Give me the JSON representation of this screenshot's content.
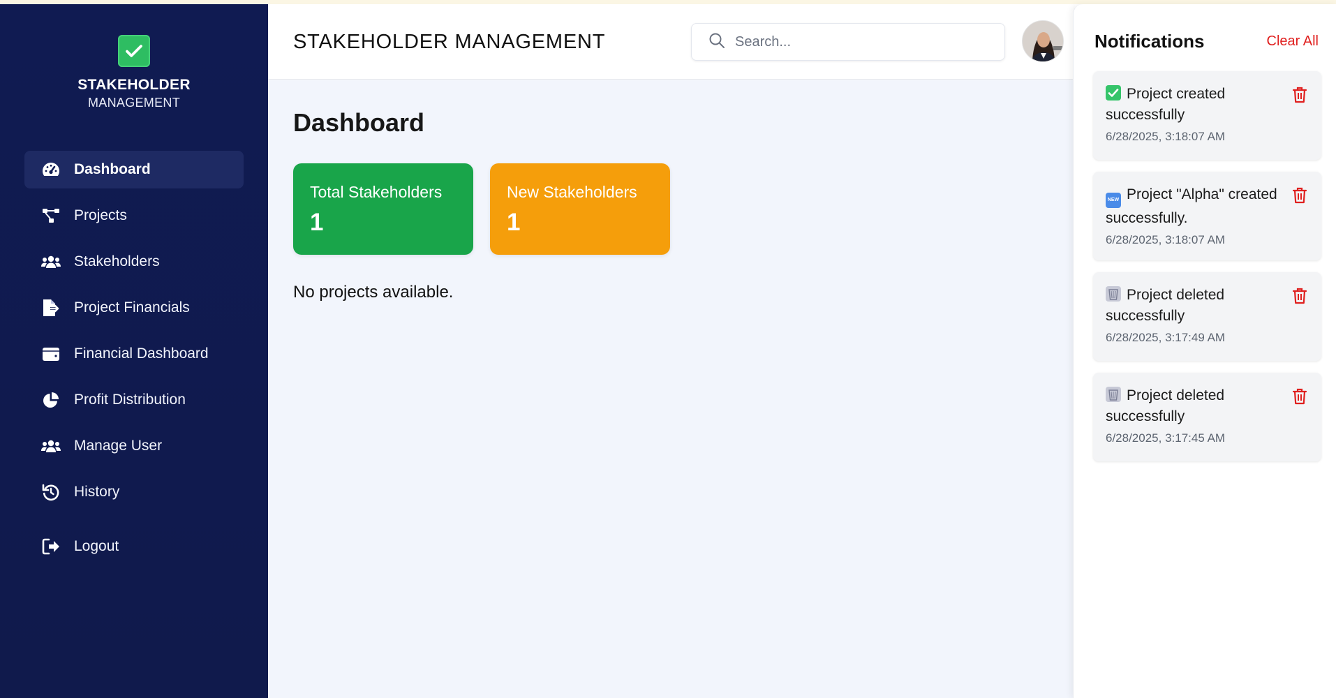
{
  "sidebar": {
    "brand": {
      "title": "STAKEHOLDER",
      "subtitle": "MANAGEMENT",
      "logo_icon": "check-square-icon"
    },
    "items": [
      {
        "label": "Dashboard",
        "icon": "gauge-icon",
        "active": true
      },
      {
        "label": "Projects",
        "icon": "project-diagram-icon"
      },
      {
        "label": "Stakeholders",
        "icon": "users-icon"
      },
      {
        "label": "Project Financials",
        "icon": "file-export-icon"
      },
      {
        "label": "Financial Dashboard",
        "icon": "wallet-icon"
      },
      {
        "label": "Profit Distribution",
        "icon": "pie-chart-icon"
      },
      {
        "label": "Manage User",
        "icon": "users-icon"
      },
      {
        "label": "History",
        "icon": "history-icon"
      }
    ],
    "logout": {
      "label": "Logout",
      "icon": "sign-out-icon"
    }
  },
  "header": {
    "title": "STAKEHOLDER MANAGEMENT",
    "search": {
      "placeholder": "Search...",
      "value": ""
    }
  },
  "main": {
    "title": "Dashboard",
    "cards": [
      {
        "label": "Total Stakeholders",
        "value": "1",
        "color": "#19a54a"
      },
      {
        "label": "New Stakeholders",
        "value": "1",
        "color": "#f59e0b"
      }
    ],
    "empty_message": "No projects available."
  },
  "notifications": {
    "title": "Notifications",
    "clear_label": "Clear All",
    "items": [
      {
        "emoji": "check-mark-emoji",
        "message": "Project created successfully",
        "time": "6/28/2025, 3:18:07 AM"
      },
      {
        "emoji": "new-emoji",
        "message": "Project \"Alpha\" created successfully.",
        "time": "6/28/2025, 3:18:07 AM"
      },
      {
        "emoji": "wastebasket-emoji",
        "message": "Project deleted successfully",
        "time": "6/28/2025, 3:17:49 AM"
      },
      {
        "emoji": "wastebasket-emoji",
        "message": "Project deleted successfully",
        "time": "6/28/2025, 3:17:45 AM"
      }
    ]
  },
  "colors": {
    "sidebar_bg": "#101b52",
    "accent_red": "#e0201f",
    "main_bg": "#f2f5fc"
  }
}
